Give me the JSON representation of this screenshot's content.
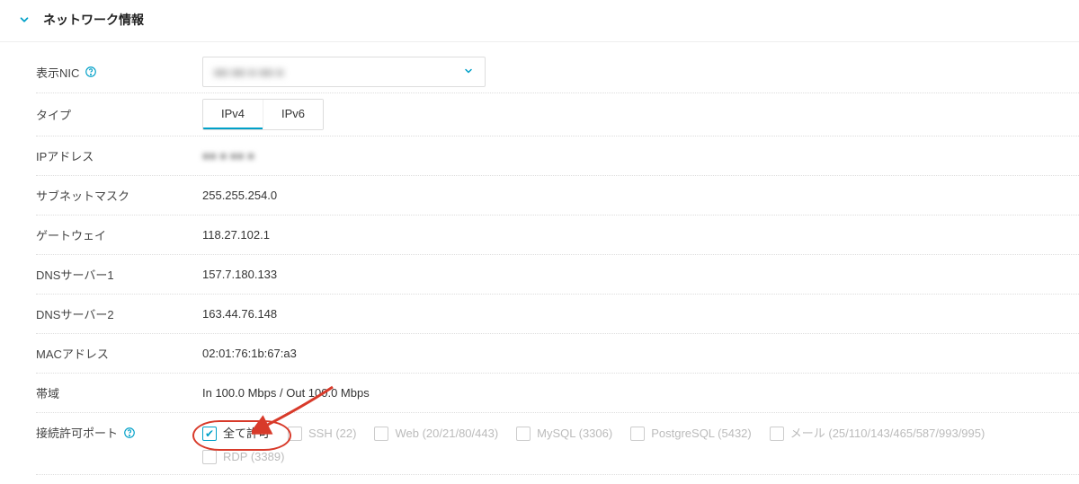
{
  "section": {
    "title": "ネットワーク情報"
  },
  "rows": {
    "nic": {
      "label": "表示NIC",
      "value_masked": "■■ ■■ ■ ■■ ■"
    },
    "type": {
      "label": "タイプ",
      "tab_ipv4": "IPv4",
      "tab_ipv6": "IPv6"
    },
    "ip": {
      "label": "IPアドレス",
      "value_masked": "■■ ■ ■■ ■"
    },
    "subnet": {
      "label": "サブネットマスク",
      "value": "255.255.254.0"
    },
    "gateway": {
      "label": "ゲートウェイ",
      "value": "118.27.102.1"
    },
    "dns1": {
      "label": "DNSサーバー1",
      "value": "157.7.180.133"
    },
    "dns2": {
      "label": "DNSサーバー2",
      "value": "163.44.76.148"
    },
    "mac": {
      "label": "MACアドレス",
      "value": "02:01:76:1b:67:a3"
    },
    "band": {
      "label": "帯域",
      "value": "In 100.0 Mbps / Out 100.0 Mbps"
    },
    "ports": {
      "label": "接続許可ポート"
    }
  },
  "ports": {
    "allow_all": {
      "label": "全て許可",
      "checked": true,
      "enabled": true
    },
    "ssh": {
      "label": "SSH (22)",
      "checked": false,
      "enabled": false
    },
    "web": {
      "label": "Web (20/21/80/443)",
      "checked": false,
      "enabled": false
    },
    "mysql": {
      "label": "MySQL (3306)",
      "checked": false,
      "enabled": false
    },
    "postgres": {
      "label": "PostgreSQL (5432)",
      "checked": false,
      "enabled": false
    },
    "mail": {
      "label": "メール (25/110/143/465/587/993/995)",
      "checked": false,
      "enabled": false
    },
    "rdp": {
      "label": "RDP (3389)",
      "checked": false,
      "enabled": false
    }
  }
}
